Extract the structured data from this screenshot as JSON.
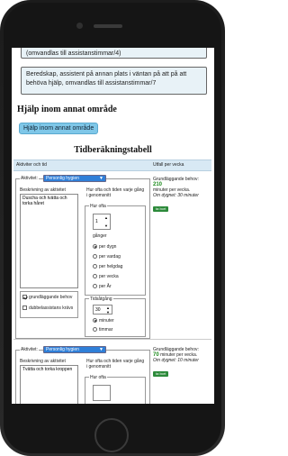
{
  "boxes": {
    "top_cut": "(omvandlas till assistanstimmar/4)",
    "beredskap": "Beredskap, assistent på annan plats i väntan på att på att behöva hjälp, omvandlas till assistanstimmar/7"
  },
  "section": {
    "title": "Hjälp inom annat område",
    "button": "Hjälp inom annat område"
  },
  "table": {
    "title": "Tidberäkningstabell",
    "col_activity": "Aktiviter och tid",
    "col_per_week": "Utfall per vecka"
  },
  "row1": {
    "activity_label": "Aktivitet:",
    "activity_value": "Personlig hygien",
    "desc_label": "Beskrivning av aktivitet",
    "desc_text": "Duscha och tvätta och torka håret",
    "freq_label": "Hur ofta och tiden varje gång i genomsnitt",
    "how_often_label": "Hur ofta",
    "count_value": "1",
    "count_unit": "gånger",
    "radios": [
      "per dygn",
      "per vardag",
      "per helgdag",
      "per vecka",
      "per År"
    ],
    "time_label": "Tidsåtgång",
    "time_value": "30",
    "time_units": [
      "minuter",
      "timmar"
    ],
    "basic_need": "grundläggande behov",
    "double": "dubbelassistans krävs",
    "summary_label": "Grundläggande behov:",
    "summary_value": "210",
    "summary_unit": "minuter per vecka.",
    "summary_note": "Om dygnet: 30 minuter",
    "summary_btn": "ta bort"
  },
  "row2": {
    "activity_label": "Aktivitet:",
    "activity_value": "Personlig hygien",
    "desc_label": "Beskrivning av aktivitet",
    "desc_text": "Tvätta och torka kroppen",
    "freq_label": "Hur ofta och tiden varje gång i genomsnitt",
    "how_often_label": "Hur ofta",
    "summary_label": "Grundläggande behov:",
    "summary_value": "70",
    "summary_unit": "minuter per vecka.",
    "summary_note": "Om dygnet: 10 minuter",
    "summary_btn": "ta bort"
  }
}
